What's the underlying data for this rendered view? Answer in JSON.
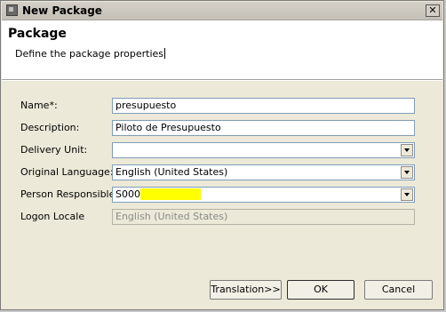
{
  "window": {
    "title": "New Package",
    "close_label": "✕"
  },
  "header": {
    "title": "Package",
    "description": "Define the package properties"
  },
  "form": {
    "name_label": "Name*:",
    "name_value": "presupuesto",
    "description_label": "Description:",
    "description_value": "Piloto de Presupuesto",
    "delivery_unit_label": "Delivery Unit:",
    "delivery_unit_value": "",
    "original_language_label": "Original Language:",
    "original_language_value": "English (United States)",
    "person_responsible_label": "Person Responsible:",
    "person_responsible_value": "S000",
    "person_responsible_redacted": "XXXXXXXXX",
    "logon_locale_label": "Logon Locale",
    "logon_locale_value": "English (United States)"
  },
  "buttons": {
    "translation": "Translation>>",
    "ok": "OK",
    "cancel": "Cancel"
  },
  "colors": {
    "highlight": "#ffff00",
    "dialog_bg": "#ece9d8",
    "header_bg": "#ffffff"
  }
}
